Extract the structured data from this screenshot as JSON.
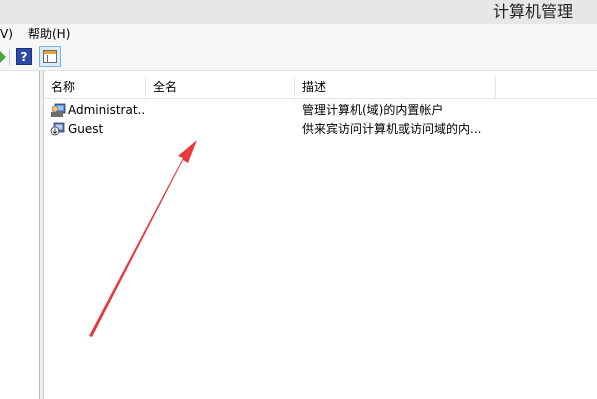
{
  "window": {
    "title": "计算机管理"
  },
  "menu": {
    "view_fragment": "V)",
    "help": "帮助(H)"
  },
  "list": {
    "columns": [
      "名称",
      "全名",
      "描述"
    ],
    "rows": [
      {
        "name": "Administrat...",
        "fullname": "",
        "description": "管理计算机(域)的内置帐户",
        "icon": "admin-user-icon"
      },
      {
        "name": "Guest",
        "fullname": "",
        "description": "供来宾访问计算机或访问域的内...",
        "icon": "guest-user-icon"
      }
    ]
  },
  "colors": {
    "annotation_arrow": "#e8383d",
    "titlebar": "#e7e7e7",
    "toolbar": "#f5f6f7"
  }
}
